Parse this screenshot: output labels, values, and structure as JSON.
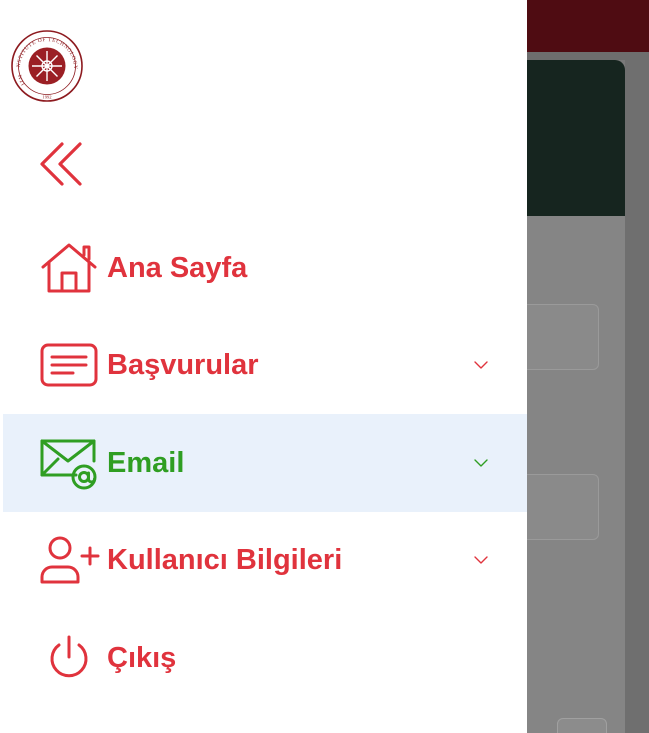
{
  "logo": {
    "top_text": "INSTITUTE OF TECHNOLOGY",
    "left_text": "İZMIR",
    "year": "1992"
  },
  "colors": {
    "accent_red": "#e0333d",
    "active_green": "#2f9e22",
    "active_bg": "#e9f1fb"
  },
  "menu": {
    "collapse_icon": "double-chevron-left-icon",
    "items": [
      {
        "label": "Ana Sayfa",
        "icon": "home-icon",
        "has_submenu": false,
        "active": false
      },
      {
        "label": "Başvurular",
        "icon": "document-list-icon",
        "has_submenu": true,
        "active": false
      },
      {
        "label": "Email",
        "icon": "email-at-icon",
        "has_submenu": true,
        "active": true
      },
      {
        "label": "Kullanıcı Bilgileri",
        "icon": "add-user-icon",
        "has_submenu": true,
        "active": false
      },
      {
        "label": "Çıkış",
        "icon": "power-icon",
        "has_submenu": false,
        "active": false
      }
    ]
  }
}
